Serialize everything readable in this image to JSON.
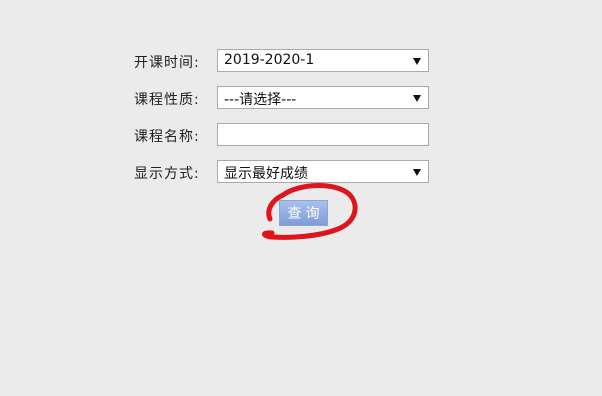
{
  "form": {
    "semester": {
      "label": "开课时间:",
      "value": "2019-2020-1"
    },
    "course_type": {
      "label": "课程性质:",
      "value": "---请选择---"
    },
    "course_name": {
      "label": "课程名称:",
      "value": "",
      "placeholder": ""
    },
    "display_mode": {
      "label": "显示方式:",
      "value": "显示最好成绩"
    },
    "query_button_label": "查询"
  },
  "annotation": {
    "color": "#e0141c"
  }
}
